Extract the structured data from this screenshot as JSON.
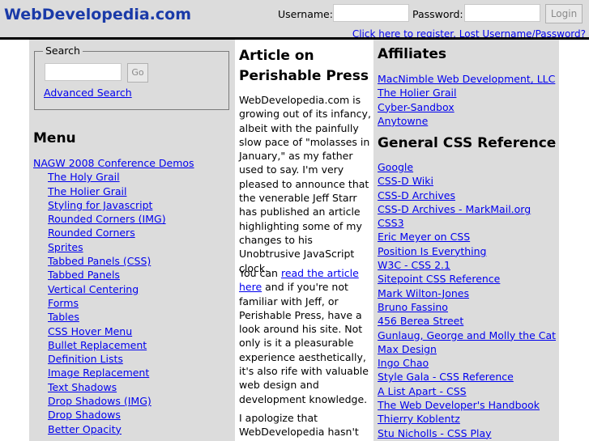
{
  "header": {
    "site_title": "WebDevelopedia.com",
    "username_label": "Username:",
    "password_label": "Password:",
    "login_button": "Login",
    "register_link": "Click here to register.",
    "lost_link": "Lost Username/Password?"
  },
  "search": {
    "legend": "Search",
    "input_value": "",
    "go_button": "Go",
    "advanced_link": "Advanced Search"
  },
  "menu": {
    "heading": "Menu",
    "items": [
      {
        "label": "NAGW 2008 Conference Demos",
        "level": 0
      },
      {
        "label": "The Holy Grail",
        "level": 1
      },
      {
        "label": "The Holier Grail",
        "level": 1
      },
      {
        "label": "Styling for Javascript",
        "level": 1
      },
      {
        "label": "Rounded Corners (IMG)",
        "level": 1
      },
      {
        "label": "Rounded Corners",
        "level": 1
      },
      {
        "label": "Sprites",
        "level": 1
      },
      {
        "label": "Tabbed Panels (CSS)",
        "level": 1
      },
      {
        "label": "Tabbed Panels",
        "level": 1
      },
      {
        "label": "Vertical Centering",
        "level": 1
      },
      {
        "label": "Forms",
        "level": 1
      },
      {
        "label": "Tables",
        "level": 1
      },
      {
        "label": "CSS Hover Menu",
        "level": 1
      },
      {
        "label": "Bullet Replacement",
        "level": 1
      },
      {
        "label": "Definition Lists",
        "level": 1
      },
      {
        "label": "Image Replacement",
        "level": 1
      },
      {
        "label": "Text Shadows",
        "level": 1
      },
      {
        "label": "Drop Shadows (IMG)",
        "level": 1
      },
      {
        "label": "Drop Shadows",
        "level": 1
      },
      {
        "label": "Better Opacity",
        "level": 1
      }
    ]
  },
  "article": {
    "title": "Article on Perishable Press",
    "para1": "WebDevelopedia.com is growing out of its infancy, albeit with the painfully slow pace of \"molasses in January,\" as my father used to say. I'm very pleased to announce that the venerable Jeff Starr has published an article highlighting some of my changes to his Unobtrusive JavaScript clock.",
    "para2_pre": "You can ",
    "para2_link": "read the article here",
    "para2_post": " and if you're not familiar with Jeff, or Perishable Press, have a look around his site. Not only is it a pleasurable experience aesthetically, it's also rife with valuable web design and development knowledge.",
    "para3": "I apologize that WebDevelopedia hasn't"
  },
  "affiliates": {
    "heading": "Affiliates",
    "items": [
      "MacNimble Web Development, LLC",
      "The Holier Grail",
      "Cyber-Sandbox",
      "Anytowne"
    ]
  },
  "css_reference": {
    "heading": "General CSS Reference",
    "items": [
      "Google",
      "CSS-D Wiki",
      "CSS-D Archives",
      "CSS-D Archives - MarkMail.org",
      "CSS3",
      "Eric Meyer on CSS",
      "Position Is Everything",
      "W3C - CSS 2.1",
      "Sitepoint CSS Reference",
      "Mark Wilton-Jones",
      "Bruno Fassino",
      "456 Berea Street",
      "Gunlaug, George and Molly the Cat",
      "Max Design",
      "Ingo Chao",
      "Style Gala - CSS Reference",
      "A List Apart - CSS",
      "The Web Developer's Handbook",
      "Thierry Koblentz",
      "Stu Nicholls - CSS Play"
    ]
  },
  "colors": {
    "header_bg": "#dcdcdc",
    "title_blue": "#1a3aa8",
    "link": "#0000ee",
    "sidebar_bg": "#dcdcdc"
  }
}
